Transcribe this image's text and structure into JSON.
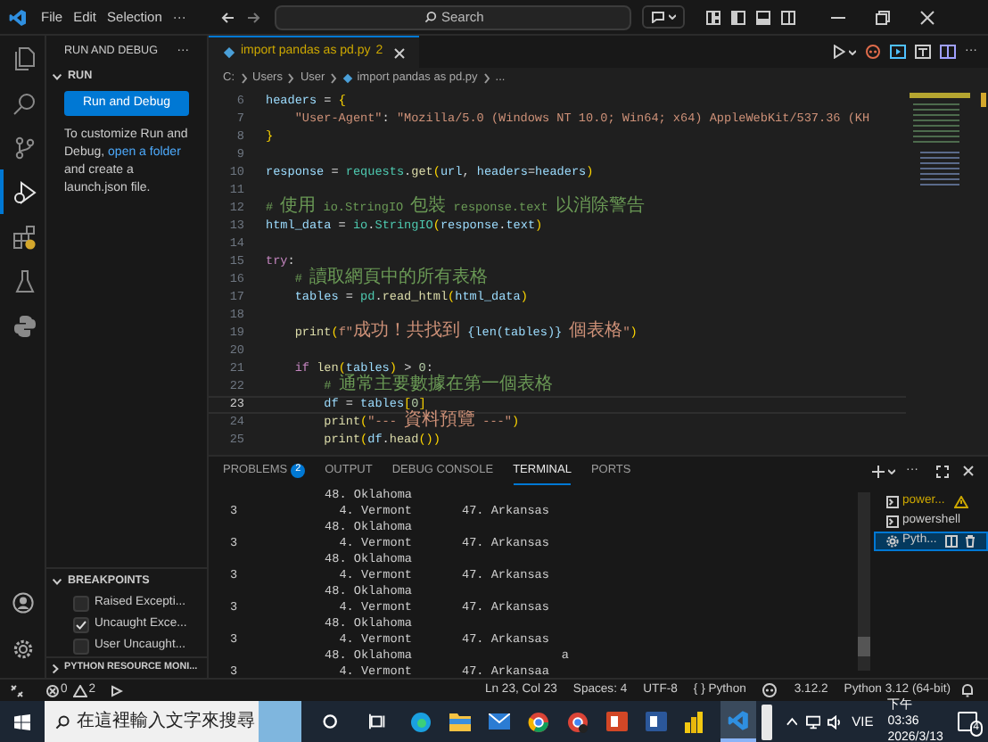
{
  "title_bar": {
    "menu": [
      "File",
      "Edit",
      "Selection",
      "···"
    ],
    "search": {
      "placeholder": "Search"
    }
  },
  "activity_bar": [
    {
      "kind": "files",
      "selected": false
    },
    {
      "kind": "search",
      "selected": false
    },
    {
      "kind": "branch",
      "selected": false
    },
    {
      "kind": "debug",
      "selected": true
    },
    {
      "kind": "blocks",
      "selected": false
    },
    {
      "kind": "flask",
      "selected": false
    },
    {
      "kind": "snake",
      "selected": false
    }
  ],
  "sidebar": {
    "title": "RUN AND DEBUG",
    "more": "···",
    "section": {
      "label": "RUN",
      "expanded": true
    },
    "button": "Run and Debug",
    "help": {
      "before": "To customize Run and Debug,",
      "link": "open a folder",
      "after": "and create a launch.json file."
    },
    "breakpoints": {
      "label": "BREAKPOINTS",
      "expanded": true,
      "items": [
        {
          "label": "Raised Excepti...",
          "checked": false
        },
        {
          "label": "Uncaught Exce...",
          "checked": true
        },
        {
          "label": "User Uncaught...",
          "checked": false
        }
      ]
    },
    "collapsed_section": {
      "label": "PYTHON RESOURCE MONI..."
    }
  },
  "editor": {
    "tabs": [
      {
        "label": "import pandas as pd.py",
        "problems": "2",
        "selected": true
      }
    ],
    "breadcrumbs": [
      "C:",
      "Users",
      "User",
      "import pandas as pd.py",
      "..."
    ],
    "lines": [
      {
        "number": "6",
        "current": false,
        "segments": [
          {
            "text": "headers",
            "kind": "var"
          },
          {
            "text": " = ",
            "kind": "plain"
          },
          {
            "text": "{",
            "kind": "bracket"
          }
        ]
      },
      {
        "number": "7",
        "current": false,
        "segments": [
          {
            "text": "    \"User-Agent\"",
            "kind": "string"
          },
          {
            "text": ": ",
            "kind": "plain"
          },
          {
            "text": "\"Mozilla/5.0 (Windows NT 10.0; Win64; x64) AppleWebKit/537.36 (KH",
            "kind": "string"
          }
        ]
      },
      {
        "number": "8",
        "current": false,
        "segments": [
          {
            "text": "}",
            "kind": "bracket"
          }
        ]
      },
      {
        "number": "9",
        "current": false
      },
      {
        "number": "10",
        "current": false,
        "segments": [
          {
            "text": "response",
            "kind": "var"
          },
          {
            "text": " = ",
            "kind": "plain"
          },
          {
            "text": "requests",
            "kind": "class"
          },
          {
            "text": ".",
            "kind": "plain"
          },
          {
            "text": "get",
            "kind": "func"
          },
          {
            "text": "(",
            "kind": "bracket"
          },
          {
            "text": "url",
            "kind": "var"
          },
          {
            "text": ", ",
            "kind": "plain"
          },
          {
            "text": "headers",
            "kind": "var"
          },
          {
            "text": "=",
            "kind": "plain"
          },
          {
            "text": "headers",
            "kind": "var"
          },
          {
            "text": ")",
            "kind": "bracket"
          }
        ]
      },
      {
        "number": "11",
        "current": false
      },
      {
        "number": "12",
        "current": false,
        "segments": [
          {
            "text": "# 使用 io.StringIO 包裝 response.text 以消除警告",
            "kind": "comment"
          }
        ]
      },
      {
        "number": "13",
        "current": false,
        "segments": [
          {
            "text": "html_data",
            "kind": "var"
          },
          {
            "text": " = ",
            "kind": "plain"
          },
          {
            "text": "io",
            "kind": "class"
          },
          {
            "text": ".",
            "kind": "plain"
          },
          {
            "text": "StringIO",
            "kind": "class"
          },
          {
            "text": "(",
            "kind": "bracket"
          },
          {
            "text": "response",
            "kind": "var"
          },
          {
            "text": ".",
            "kind": "plain"
          },
          {
            "text": "text",
            "kind": "var"
          },
          {
            "text": ")",
            "kind": "bracket"
          }
        ]
      },
      {
        "number": "14",
        "current": false
      },
      {
        "number": "15",
        "current": false,
        "segments": [
          {
            "text": "try",
            "kind": "keyword"
          },
          {
            "text": ":",
            "kind": "plain"
          }
        ]
      },
      {
        "number": "16",
        "current": false,
        "segments": [
          {
            "text": "    # 讀取網頁中的所有表格",
            "kind": "comment"
          }
        ]
      },
      {
        "number": "17",
        "current": false,
        "segments": [
          {
            "text": "    tables",
            "kind": "var"
          },
          {
            "text": " = ",
            "kind": "plain"
          },
          {
            "text": "pd",
            "kind": "class"
          },
          {
            "text": ".",
            "kind": "plain"
          },
          {
            "text": "read_html",
            "kind": "func"
          },
          {
            "text": "(",
            "kind": "bracket"
          },
          {
            "text": "html_data",
            "kind": "var"
          },
          {
            "text": ")",
            "kind": "bracket"
          }
        ]
      },
      {
        "number": "18",
        "current": false
      },
      {
        "number": "19",
        "current": false,
        "segments": [
          {
            "text": "    print",
            "kind": "func"
          },
          {
            "text": "(",
            "kind": "bracket"
          },
          {
            "text": "f\"成功！共找到 ",
            "kind": "string"
          },
          {
            "text": "{len(tables)}",
            "kind": "var"
          },
          {
            "text": " 個表格\"",
            "kind": "string"
          },
          {
            "text": ")",
            "kind": "bracket"
          }
        ]
      },
      {
        "number": "20",
        "current": false
      },
      {
        "number": "21",
        "current": false,
        "segments": [
          {
            "text": "    if",
            "kind": "keyword"
          },
          {
            "text": " len",
            "kind": "func"
          },
          {
            "text": "(",
            "kind": "bracket"
          },
          {
            "text": "tables",
            "kind": "var"
          },
          {
            "text": ")",
            "kind": "bracket"
          },
          {
            "text": " > ",
            "kind": "plain"
          },
          {
            "text": "0",
            "kind": "number"
          },
          {
            "text": ":",
            "kind": "plain"
          }
        ]
      },
      {
        "number": "22",
        "current": false,
        "segments": [
          {
            "text": "        # 通常主要數據在第一個表格",
            "kind": "comment"
          }
        ]
      },
      {
        "number": "23",
        "current": true,
        "segments": [
          {
            "text": "        df",
            "kind": "var"
          },
          {
            "text": " = ",
            "kind": "plain"
          },
          {
            "text": "tables",
            "kind": "var"
          },
          {
            "text": "[",
            "kind": "bracket"
          },
          {
            "text": "0",
            "kind": "number"
          },
          {
            "text": "]",
            "kind": "bracket"
          }
        ]
      },
      {
        "number": "24",
        "current": false,
        "segments": [
          {
            "text": "        print",
            "kind": "func"
          },
          {
            "text": "(",
            "kind": "bracket"
          },
          {
            "text": "\"--- 資料預覽 ---\"",
            "kind": "string"
          },
          {
            "text": ")",
            "kind": "bracket"
          }
        ]
      },
      {
        "number": "25",
        "current": false,
        "segments": [
          {
            "text": "        print",
            "kind": "func"
          },
          {
            "text": "(",
            "kind": "bracket"
          },
          {
            "text": "df",
            "kind": "var"
          },
          {
            "text": ".",
            "kind": "plain"
          },
          {
            "text": "head",
            "kind": "func"
          },
          {
            "text": "()",
            "kind": "bracket"
          },
          {
            "text": ")",
            "kind": "bracket"
          }
        ]
      }
    ]
  },
  "panel": {
    "tabs": [
      {
        "label": "PROBLEMS",
        "badge": "2",
        "selected": false
      },
      {
        "label": "OUTPUT",
        "selected": false
      },
      {
        "label": "DEBUG CONSOLE",
        "selected": false
      },
      {
        "label": "TERMINAL",
        "selected": true
      },
      {
        "label": "PORTS",
        "selected": false
      }
    ],
    "terminal_rows": [
      {
        "column_2": "48. Oklahoma"
      },
      {
        "column_1": "3",
        "column_2": "4. Vermont",
        "column_3": "47. Arkansas"
      },
      {
        "column_2": "48. Oklahoma"
      },
      {
        "column_1": "3",
        "column_2": "4. Vermont",
        "column_3": "47. Arkansas"
      },
      {
        "column_2": "48. Oklahoma"
      },
      {
        "column_1": "3",
        "column_2": "4. Vermont",
        "column_3": "47. Arkansas"
      },
      {
        "column_2": "48. Oklahoma"
      },
      {
        "column_1": "3",
        "column_2": "4. Vermont",
        "column_3": "47. Arkansas"
      },
      {
        "column_2": "48. Oklahoma"
      },
      {
        "column_1": "3",
        "column_2": "4. Vermont",
        "column_3": "47. Arkansas"
      },
      {
        "column_2": "48. Oklahoma",
        "column_3": "a"
      },
      {
        "column_1": "3",
        "column_2": "4. Vermont",
        "column_3": "47. Arkansaa"
      }
    ],
    "terminals": [
      {
        "label": "power...",
        "warning": true,
        "selected": false
      },
      {
        "label": "powershell",
        "warning": false,
        "selected": false
      },
      {
        "label": "Pyth...",
        "warning": false,
        "selected": true
      }
    ]
  },
  "status_bar": {
    "errors": "0",
    "warnings": "2",
    "items": [
      "Ln 23, Col 23",
      "Spaces: 4",
      "UTF-8",
      "{ } Python",
      "3.12.2",
      "Python 3.12 (64-bit)"
    ]
  },
  "taskbar": {
    "search": {
      "placeholder": "在這裡輸入文字來搜尋"
    },
    "language": "VIE",
    "time": "下午 03:36",
    "date": "2026/3/13",
    "notifications": "4"
  }
}
